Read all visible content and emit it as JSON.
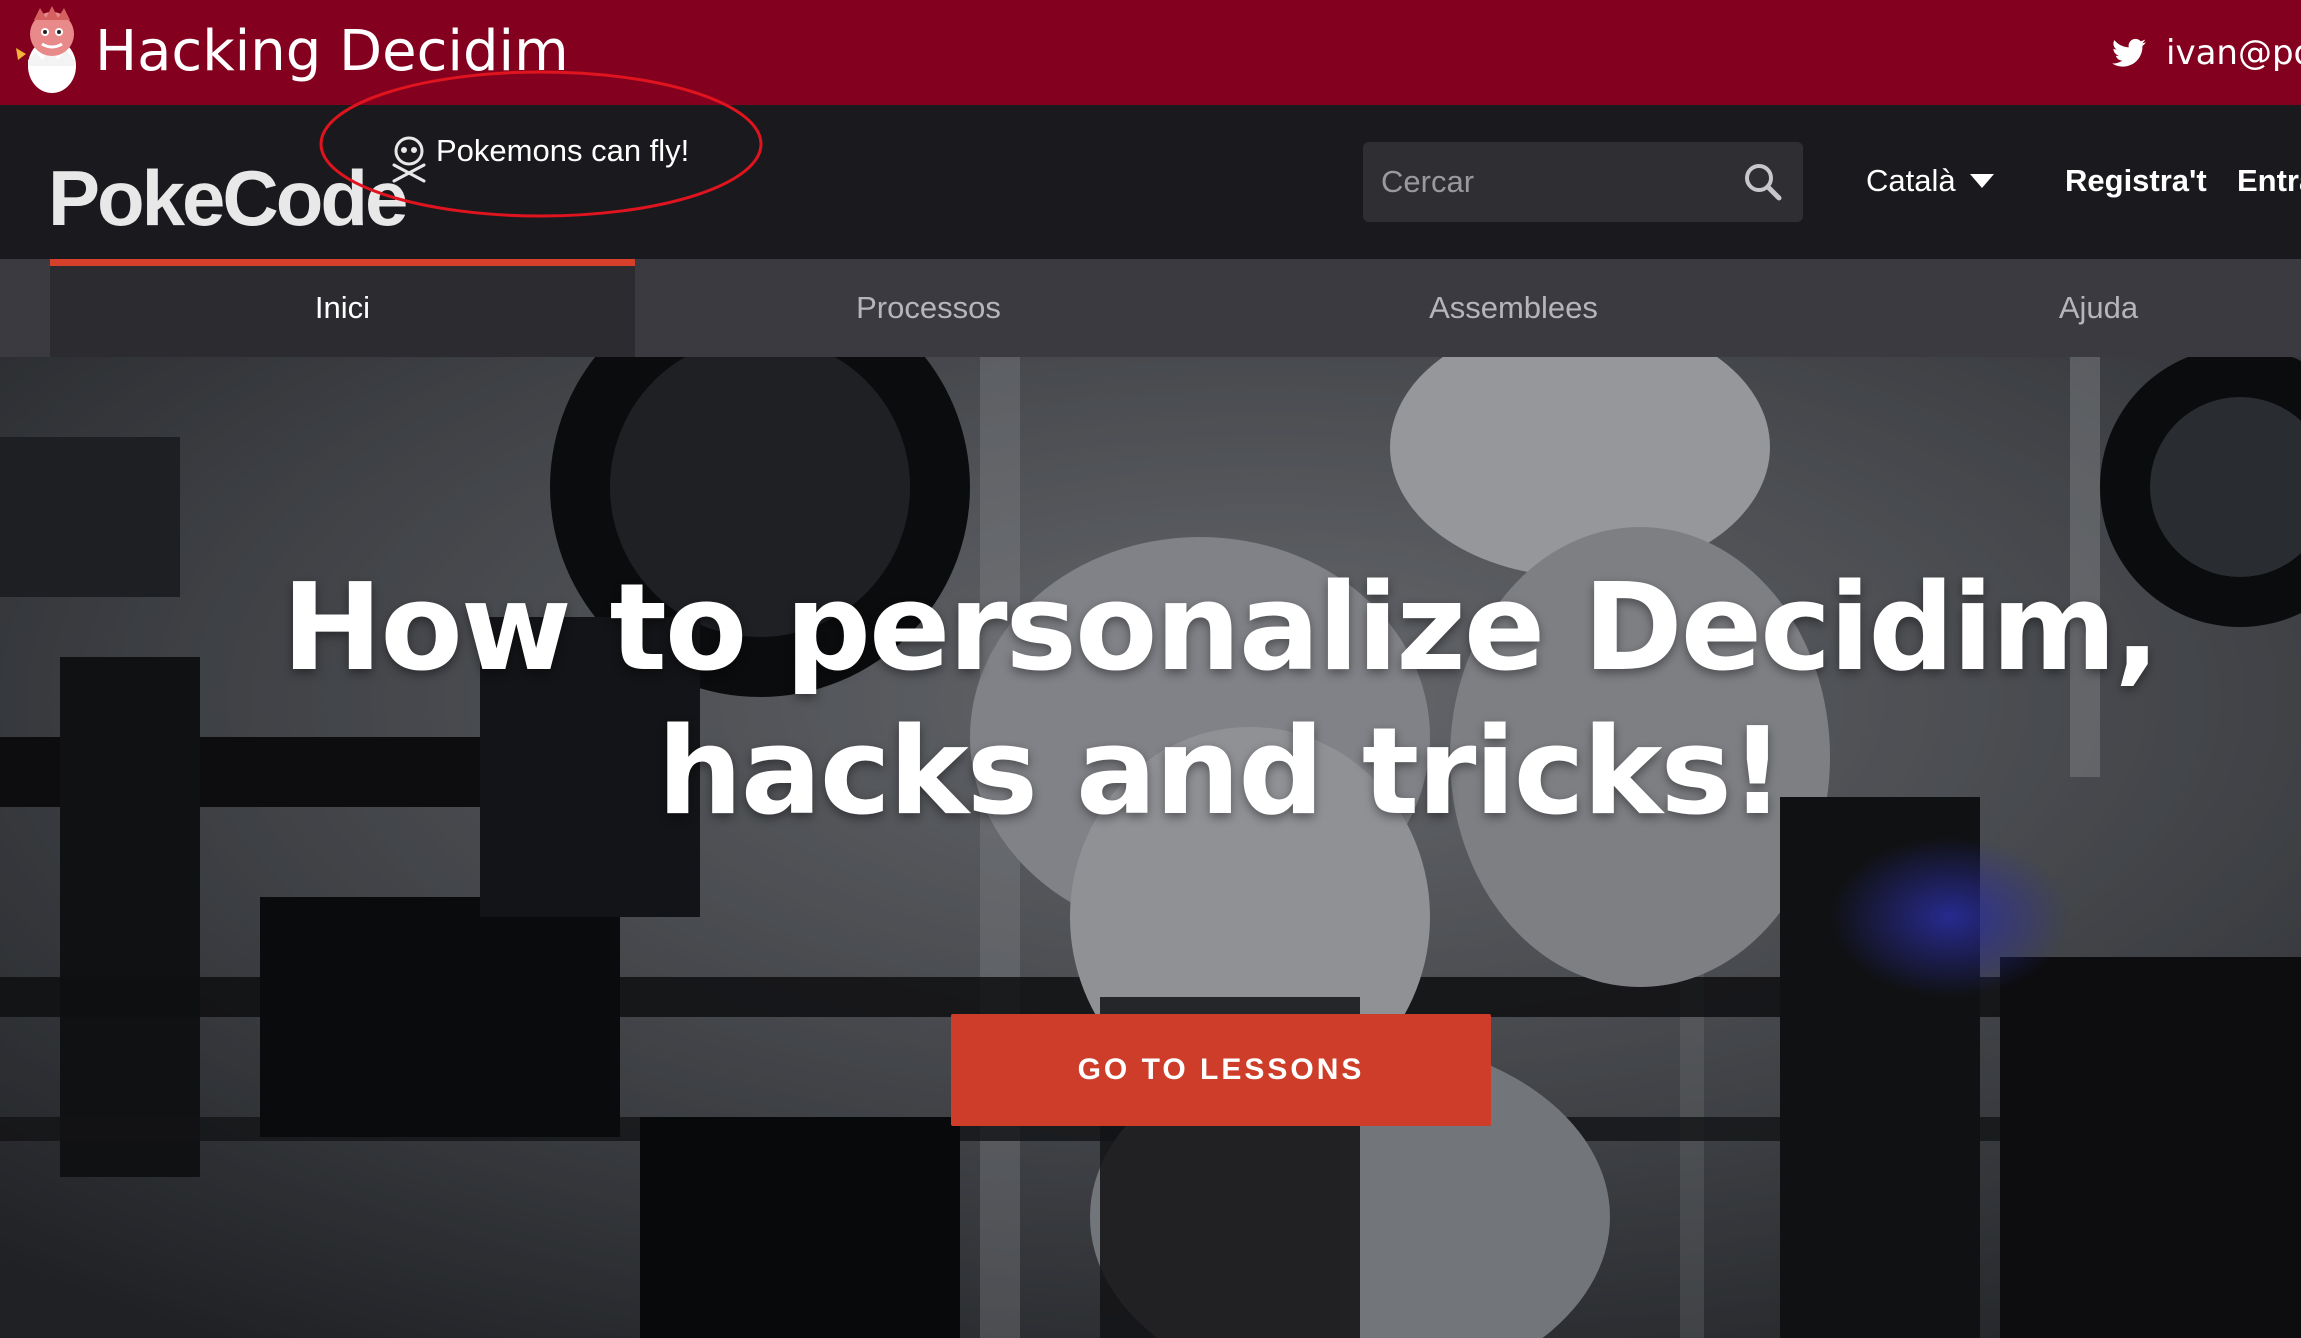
{
  "slide": {
    "title": "Hacking Decidim",
    "twitter_handle": "ivan@poke"
  },
  "header": {
    "brand": "PokeCode",
    "tagline": "Pokemons can fly!",
    "search": {
      "placeholder": "Cercar",
      "value": ""
    },
    "language": "Català",
    "register_label": "Registra't",
    "login_label": "Entra"
  },
  "nav": {
    "tabs": [
      {
        "label": "Inici",
        "active": true
      },
      {
        "label": "Processos",
        "active": false
      },
      {
        "label": "Assemblees",
        "active": false
      },
      {
        "label": "Ajuda",
        "active": false
      }
    ]
  },
  "hero": {
    "title_line1": "How to personalize Decidim,",
    "title_line2": "hacks and tricks!",
    "cta_label": "GO TO LESSONS"
  },
  "colors": {
    "slide_bar": "#83001e",
    "header_bg": "#1a1a1e",
    "nav_bg": "#3a3a40",
    "accent": "#d7412b",
    "cta": "#cd3d29",
    "annotation": "#e0141e"
  },
  "icons": {
    "slide_logo": "pokemon-egg-icon",
    "twitter": "twitter-icon",
    "brand_mark": "skull-crossbones-icon",
    "search": "search-icon",
    "language_caret": "caret-down-icon"
  }
}
